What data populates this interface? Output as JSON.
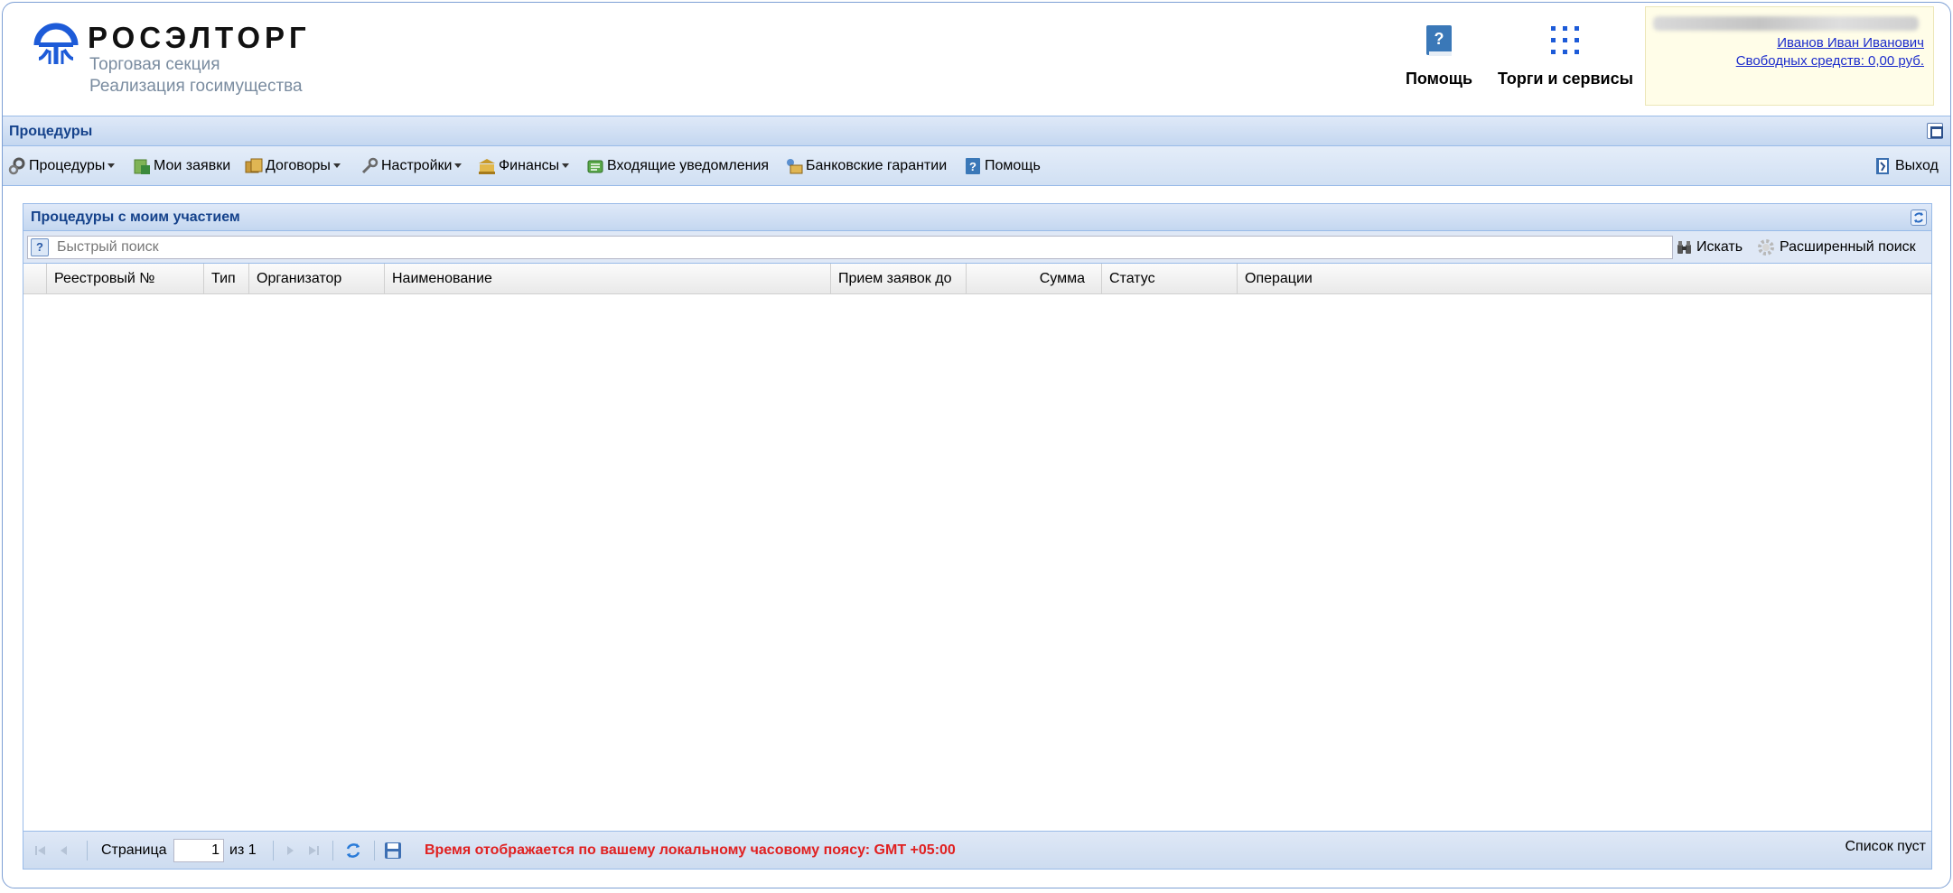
{
  "header": {
    "logo_word": "РОСЭЛТОРГ",
    "logo_sub1": "Торговая секция",
    "logo_sub2": "Реализация госимущества",
    "help_label": "Помощь",
    "services_label": "Торги и сервисы",
    "user_name": "Иванов Иван Иванович",
    "user_funds": "Свободных средств: 0,00 руб."
  },
  "titlebar": {
    "title": "Процедуры"
  },
  "menu": {
    "procedures": "Процедуры",
    "my_bids": "Мои заявки",
    "contracts": "Договоры",
    "settings": "Настройки",
    "finance": "Финансы",
    "notifications": "Входящие уведомления",
    "guarantees": "Банковские гарантии",
    "help": "Помощь",
    "exit": "Выход"
  },
  "panel": {
    "title": "Процедуры с моим участием",
    "search_placeholder": "Быстрый поиск",
    "search_button": "Искать",
    "advanced_search": "Расширенный поиск"
  },
  "grid": {
    "columns": [
      "",
      "Реестровый №",
      "Тип",
      "Организатор",
      "Наименование",
      "Прием заявок до",
      "Сумма",
      "Статус",
      "Операции"
    ],
    "rows": []
  },
  "paging": {
    "page_label": "Страница",
    "page_value": "1",
    "of_label": "из 1",
    "timezone_note": "Время отображается по вашему локальному часовому поясу: GMT +05:00",
    "empty_message": "Список пуст"
  },
  "colors": {
    "brand_blue": "#1d5bd8",
    "panel_title": "#15428b",
    "accent_red": "#e02020",
    "link": "#1c2ccc"
  }
}
